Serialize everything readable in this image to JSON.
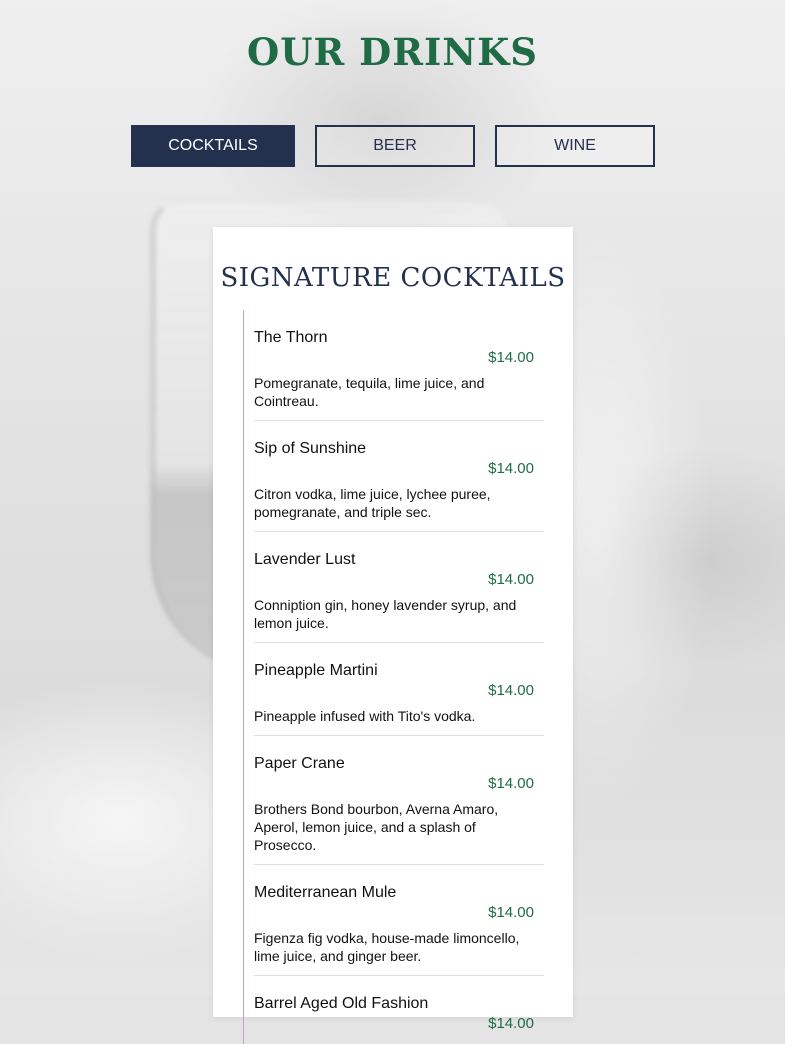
{
  "page": {
    "title": "OUR DRINKS"
  },
  "tabs": [
    {
      "label": "COCKTAILS",
      "active": true
    },
    {
      "label": "BEER",
      "active": false
    },
    {
      "label": "WINE",
      "active": false
    }
  ],
  "menu": {
    "heading": "SIGNATURE COCKTAILS",
    "items": [
      {
        "name": "The Thorn",
        "price": "$14.00",
        "description": "Pomegranate, tequila, lime juice, and Cointreau."
      },
      {
        "name": "Sip of Sunshine",
        "price": "$14.00",
        "description": "Citron vodka, lime juice, lychee puree, pomegranate, and triple sec."
      },
      {
        "name": "Lavender Lust",
        "price": "$14.00",
        "description": "Conniption gin, honey lavender syrup, and lemon juice."
      },
      {
        "name": "Pineapple Martini",
        "price": "$14.00",
        "description": "Pineapple infused with Tito's vodka."
      },
      {
        "name": "Paper Crane",
        "price": "$14.00",
        "description": "Brothers Bond bourbon, Averna Amaro, Aperol, lemon juice, and a splash of Prosecco."
      },
      {
        "name": "Mediterranean Mule",
        "price": "$14.00",
        "description": "Figenza fig vodka, house-made limoncello, lime juice, and ginger beer."
      },
      {
        "name": "Barrel Aged Old Fashion",
        "price": "$14.00",
        "description": ""
      }
    ]
  },
  "colors": {
    "title_green": "#1f6b45",
    "navy": "#23314f",
    "accent_line": "#c99ec9"
  }
}
